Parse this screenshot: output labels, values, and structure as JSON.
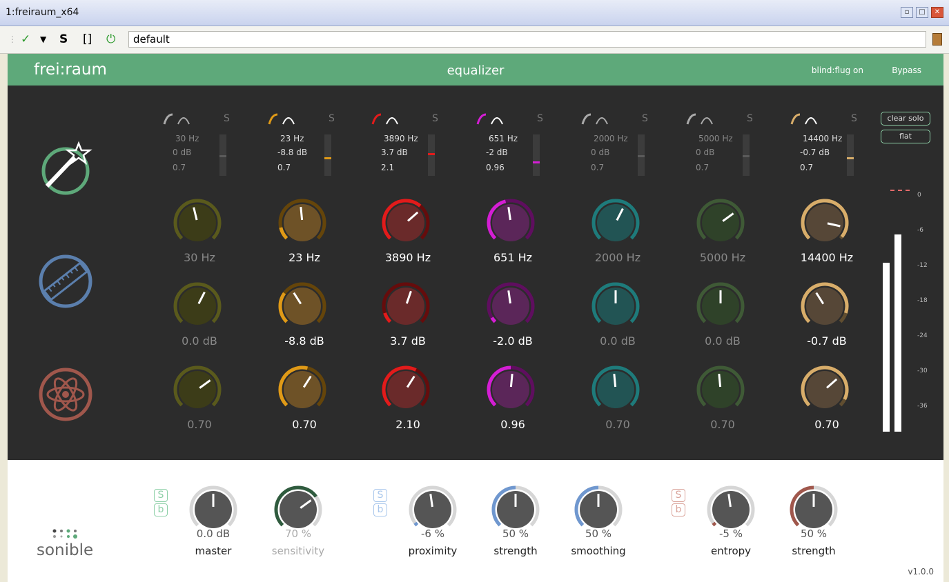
{
  "window": {
    "title": "1:freiraum_x64",
    "controls": [
      "▫",
      "□",
      "✕"
    ]
  },
  "toolbar": {
    "check": "✓",
    "dropdown": "▼",
    "s": "S",
    "bracket": "[]",
    "power": "⏻",
    "preset": "default"
  },
  "header": {
    "logo": "frei:raum",
    "mode": "equalizer",
    "blind": "blind:flug on",
    "bypass": "Bypass"
  },
  "colors": {
    "green": "#5ea97a",
    "blue": "#5b7fad",
    "brown": "#a0574c"
  },
  "bands": [
    {
      "color": "#6b6b22",
      "ring": "#5a5a1c",
      "thumb": "#3c3c18",
      "active": false,
      "head_freq": "30 Hz",
      "head_gain": "0 dB",
      "head_q": "0.7",
      "freq": "30 Hz",
      "gain": "0.0 dB",
      "q": "0.70",
      "meter": 0.5,
      "f_pos": 0.45,
      "g_pos": 0.6,
      "q_pos": 0.7,
      "f_arc": 0,
      "g_arc": 0,
      "q_arc": 0
    },
    {
      "color": "#e09a17",
      "ring": "#e09a17",
      "thumb": "#6e5227",
      "active": true,
      "head_freq": "23 Hz",
      "head_gain": "-8.8 dB",
      "head_q": "0.7",
      "freq": "23 Hz",
      "gain": "-8.8 dB",
      "q": "0.70",
      "meter": 0.55,
      "f_pos": 0.48,
      "g_pos": 0.38,
      "q_pos": 0.62,
      "f_arc": 0.12,
      "g_arc": 0.3,
      "q_arc": 0.55
    },
    {
      "color": "#e21b1b",
      "ring": "#e21b1b",
      "thumb": "#6a2a2a",
      "active": true,
      "head_freq": "3890 Hz",
      "head_gain": "3.7 dB",
      "head_q": "2.1",
      "freq": "3890 Hz",
      "gain": "3.7 dB",
      "q": "2.10",
      "meter": 0.45,
      "f_pos": 0.68,
      "g_pos": 0.57,
      "q_pos": 0.62,
      "f_arc": 0.65,
      "g_arc": 0.1,
      "q_arc": 0.6
    },
    {
      "color": "#d41ed4",
      "ring": "#d41ed4",
      "thumb": "#5b2659",
      "active": true,
      "head_freq": "651 Hz",
      "head_gain": "-2 dB",
      "head_q": "0.96",
      "freq": "651 Hz",
      "gain": "-2.0 dB",
      "q": "0.96",
      "meter": 0.65,
      "f_pos": 0.47,
      "g_pos": 0.47,
      "q_pos": 0.52,
      "f_arc": 0.45,
      "g_arc": 0.05,
      "q_arc": 0.5
    },
    {
      "color": "#1e7b7b",
      "ring": "#1e7b7b",
      "thumb": "#225454",
      "active": false,
      "head_freq": "2000 Hz",
      "head_gain": "0 dB",
      "head_q": "0.7",
      "freq": "2000 Hz",
      "gain": "0.0 dB",
      "q": "0.70",
      "meter": 0.5,
      "f_pos": 0.6,
      "g_pos": 0.5,
      "q_pos": 0.48,
      "f_arc": 0,
      "g_arc": 0,
      "q_arc": 0
    },
    {
      "color": "#3f5a36",
      "ring": "#3f5a36",
      "thumb": "#2f4229",
      "active": false,
      "head_freq": "5000 Hz",
      "head_gain": "0 dB",
      "head_q": "0.7",
      "freq": "5000 Hz",
      "gain": "0.0 dB",
      "q": "0.70",
      "meter": 0.5,
      "f_pos": 0.7,
      "g_pos": 0.5,
      "q_pos": 0.48,
      "f_arc": 0,
      "g_arc": 0,
      "q_arc": 0
    },
    {
      "color": "#d8ad6a",
      "ring": "#d8ad6a",
      "thumb": "#564737",
      "active": true,
      "head_freq": "14400 Hz",
      "head_gain": "-0.7 dB",
      "head_q": "0.7",
      "freq": "14400 Hz",
      "gain": "-0.7 dB",
      "q": "0.70",
      "meter": 0.55,
      "f_pos": 0.88,
      "g_pos": 0.38,
      "q_pos": 0.68,
      "f_arc": 0.98,
      "g_arc": 0.9,
      "q_arc": 0.93
    }
  ],
  "band_solo": "S",
  "right": {
    "clear_solo": "clear solo",
    "flat": "flat",
    "scale": [
      "0",
      "-6",
      "-12",
      "-18",
      "-24",
      "-30",
      "-36"
    ],
    "level_left": 0.72,
    "level_right": 0.84
  },
  "bottom": {
    "sb_labels": [
      "S",
      "b"
    ],
    "groups": [
      {
        "sb_color": "#8ed0a8",
        "knobs": [
          {
            "value": "0.0 dB",
            "name": "master",
            "pos": 0.5,
            "arc": 0,
            "arc_color": "#666"
          },
          {
            "value": "70 %",
            "name": "sensitivity",
            "pos": 0.7,
            "arc": 0.7,
            "arc_color": "#2f5b3e",
            "dim": true
          }
        ]
      },
      {
        "sb_color": "#a9c7ec",
        "knobs": [
          {
            "value": "-6 %",
            "name": "proximity",
            "pos": 0.47,
            "arc": 0.03,
            "arc_color": "#6f97cf"
          },
          {
            "value": "50 %",
            "name": "strength",
            "pos": 0.5,
            "arc": 0.5,
            "arc_color": "#6f97cf"
          },
          {
            "value": "50 %",
            "name": "smoothing",
            "pos": 0.5,
            "arc": 0.5,
            "arc_color": "#6f97cf"
          }
        ]
      },
      {
        "sb_color": "#d9a39a",
        "knobs": [
          {
            "value": "-5 %",
            "name": "entropy",
            "pos": 0.47,
            "arc": 0.03,
            "arc_color": "#a0574c"
          },
          {
            "value": "50 %",
            "name": "strength",
            "pos": 0.5,
            "arc": 0.5,
            "arc_color": "#a0574c"
          }
        ]
      }
    ],
    "brand": "sonible",
    "version": "v1.0.0"
  }
}
